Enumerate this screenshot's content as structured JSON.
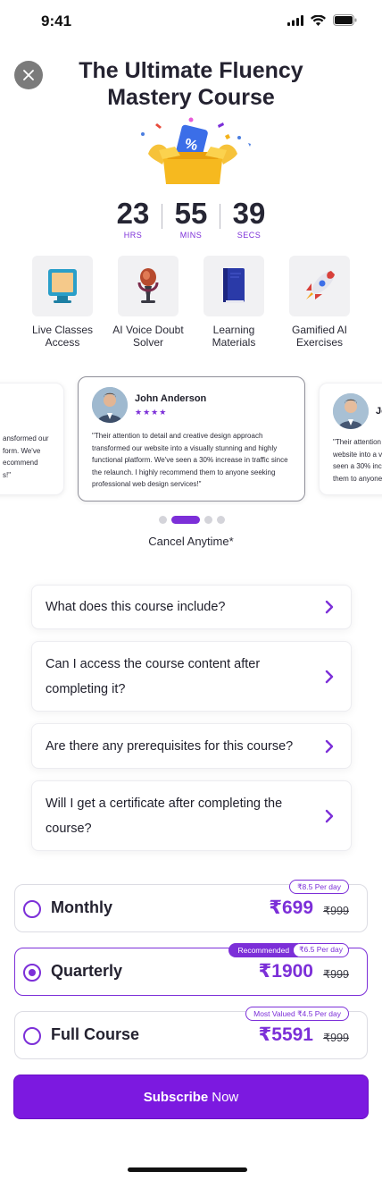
{
  "status_bar": {
    "time": "9:41"
  },
  "header": {
    "title": "The Ultimate Fluency Mastery Course",
    "close_icon": "close-icon"
  },
  "countdown": [
    {
      "value": "23",
      "label": "HRS"
    },
    {
      "value": "55",
      "label": "MINS"
    },
    {
      "value": "39",
      "label": "SECS"
    }
  ],
  "features": [
    {
      "label": "Live Classes Access",
      "icon": "monitor-icon"
    },
    {
      "label": "AI Voice Doubt Solver",
      "icon": "microphone-icon"
    },
    {
      "label": "Learning Materials",
      "icon": "book-icon"
    },
    {
      "label": "Gamified AI Exercises",
      "icon": "rocket-icon"
    }
  ],
  "testimonials": {
    "left_text": "ansformed our\nform. We've\necommend\ns!\"",
    "center": {
      "name": "John Anderson",
      "stars": "★★★★",
      "text": "\"Their attention to detail and creative design approach transformed our website into a visually stunning and highly functional platform. We've seen a 30% increase in traffic since the relaunch. I highly recommend them to anyone seeking professional web design services!\""
    },
    "right": {
      "name": "Jo",
      "text": "\"Their attention\nwebsite into a v\nseen a 30% inc\nthem to anyone"
    },
    "active_slide": 2,
    "slide_count": 4
  },
  "cancel_anytime": "Cancel Anytime*",
  "faq": [
    {
      "question": "What does this course include?"
    },
    {
      "question": "Can I access the course content after completing it?"
    },
    {
      "question": "Are there any prerequisites for this course?"
    },
    {
      "question": "Will I get a certificate after completing the course?"
    }
  ],
  "plans": [
    {
      "name": "Monthly",
      "price": "₹699",
      "old_price": "₹999",
      "per_day": "₹8.5 Per day",
      "badge": "",
      "selected": false
    },
    {
      "name": "Quarterly",
      "price": "₹1900",
      "old_price": "₹999",
      "per_day": "₹6.5 Per day",
      "badge": "Recommended",
      "selected": true
    },
    {
      "name": "Full Course",
      "price": "₹5591",
      "old_price": "₹999",
      "per_day": "₹4.5 Per day",
      "badge": "Most Valued",
      "selected": false
    }
  ],
  "subscribe": {
    "bold": "Subscribe",
    "light": "Now"
  },
  "colors": {
    "accent": "#7c2fd8",
    "button": "#7c19e0"
  }
}
